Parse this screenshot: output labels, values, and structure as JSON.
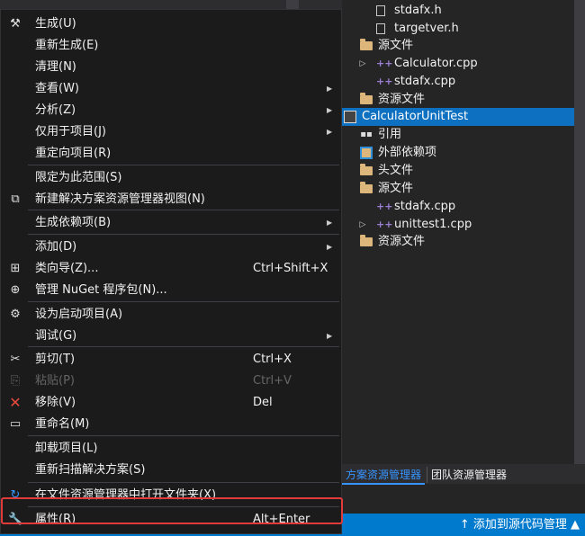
{
  "solution_explorer": {
    "items": [
      {
        "label": "stdafx.h",
        "icon": "header-file-icon",
        "depth": 2,
        "arrow": ""
      },
      {
        "label": "targetver.h",
        "icon": "header-file-icon",
        "depth": 2,
        "arrow": ""
      },
      {
        "label": "源文件",
        "icon": "folder-icon",
        "depth": 1,
        "arrow": ""
      },
      {
        "label": "Calculator.cpp",
        "icon": "cpp-file-icon",
        "depth": 2,
        "arrow": "▷"
      },
      {
        "label": "stdafx.cpp",
        "icon": "cpp-file-icon",
        "depth": 2,
        "arrow": ""
      },
      {
        "label": "资源文件",
        "icon": "folder-icon",
        "depth": 1,
        "arrow": ""
      },
      {
        "label": "CalculatorUnitTest",
        "icon": "project-icon",
        "depth": 0,
        "arrow": "",
        "selected": true
      },
      {
        "label": "引用",
        "icon": "references-icon",
        "depth": 1,
        "arrow": ""
      },
      {
        "label": "外部依赖项",
        "icon": "external-deps-icon",
        "depth": 1,
        "arrow": ""
      },
      {
        "label": "头文件",
        "icon": "folder-icon",
        "depth": 1,
        "arrow": ""
      },
      {
        "label": "源文件",
        "icon": "folder-icon",
        "depth": 1,
        "arrow": ""
      },
      {
        "label": "stdafx.cpp",
        "icon": "cpp-file-icon",
        "depth": 2,
        "arrow": ""
      },
      {
        "label": "unittest1.cpp",
        "icon": "cpp-file-icon",
        "depth": 2,
        "arrow": "▷"
      },
      {
        "label": "资源文件",
        "icon": "folder-icon",
        "depth": 1,
        "arrow": ""
      }
    ],
    "tabs": [
      {
        "label": "方案资源管理器",
        "active": true
      },
      {
        "label": "团队资源管理器",
        "active": false
      }
    ]
  },
  "status_bar": {
    "source_control": "↑ 添加到源代码管理 ▲"
  },
  "context_menu": {
    "items": [
      {
        "name": "build",
        "label": "生成(U)",
        "shortcut": "",
        "icon": "build-icon",
        "submenu": false,
        "disabled": false
      },
      {
        "name": "rebuild",
        "label": "重新生成(E)",
        "shortcut": "",
        "icon": "",
        "submenu": false,
        "disabled": false
      },
      {
        "name": "clean",
        "label": "清理(N)",
        "shortcut": "",
        "icon": "",
        "submenu": false,
        "disabled": false
      },
      {
        "name": "view",
        "label": "查看(W)",
        "shortcut": "",
        "icon": "",
        "submenu": true,
        "disabled": false
      },
      {
        "name": "analyze",
        "label": "分析(Z)",
        "shortcut": "",
        "icon": "",
        "submenu": true,
        "disabled": false
      },
      {
        "name": "project-only",
        "label": "仅用于项目(J)",
        "shortcut": "",
        "icon": "",
        "submenu": true,
        "disabled": false
      },
      {
        "name": "retarget",
        "label": "重定向项目(R)",
        "shortcut": "",
        "icon": "",
        "submenu": false,
        "disabled": false
      },
      {
        "name": "scope-to-this",
        "label": "限定为此范围(S)",
        "shortcut": "",
        "icon": "",
        "submenu": false,
        "disabled": false
      },
      {
        "name": "new-explorer-view",
        "label": "新建解决方案资源管理器视图(N)",
        "shortcut": "",
        "icon": "new-view-icon",
        "submenu": false,
        "disabled": false
      },
      {
        "name": "build-dependencies",
        "label": "生成依赖项(B)",
        "shortcut": "",
        "icon": "",
        "submenu": true,
        "disabled": false
      },
      {
        "name": "add",
        "label": "添加(D)",
        "shortcut": "",
        "icon": "",
        "submenu": true,
        "disabled": false
      },
      {
        "name": "class-wizard",
        "label": "类向导(Z)...",
        "shortcut": "Ctrl+Shift+X",
        "icon": "class-wizard-icon",
        "submenu": false,
        "disabled": false
      },
      {
        "name": "manage-nuget",
        "label": "管理 NuGet 程序包(N)...",
        "shortcut": "",
        "icon": "nuget-icon",
        "submenu": false,
        "disabled": false
      },
      {
        "name": "set-startup",
        "label": "设为启动项目(A)",
        "shortcut": "",
        "icon": "gear-icon",
        "submenu": false,
        "disabled": false
      },
      {
        "name": "debug",
        "label": "调试(G)",
        "shortcut": "",
        "icon": "",
        "submenu": true,
        "disabled": false
      },
      {
        "name": "cut",
        "label": "剪切(T)",
        "shortcut": "Ctrl+X",
        "icon": "scissors-icon",
        "submenu": false,
        "disabled": false
      },
      {
        "name": "paste",
        "label": "粘贴(P)",
        "shortcut": "Ctrl+V",
        "icon": "paste-icon",
        "submenu": false,
        "disabled": true
      },
      {
        "name": "remove",
        "label": "移除(V)",
        "shortcut": "Del",
        "icon": "remove-icon",
        "submenu": false,
        "disabled": false
      },
      {
        "name": "rename",
        "label": "重命名(M)",
        "shortcut": "",
        "icon": "rename-icon",
        "submenu": false,
        "disabled": false
      },
      {
        "name": "unload",
        "label": "卸载项目(L)",
        "shortcut": "",
        "icon": "",
        "submenu": false,
        "disabled": false
      },
      {
        "name": "rescan",
        "label": "重新扫描解决方案(S)",
        "shortcut": "",
        "icon": "",
        "submenu": false,
        "disabled": false
      },
      {
        "name": "open-in-explorer",
        "label": "在文件资源管理器中打开文件夹(X)",
        "shortcut": "",
        "icon": "open-folder-icon",
        "submenu": false,
        "disabled": false
      },
      {
        "name": "properties",
        "label": "属性(R)",
        "shortcut": "Alt+Enter",
        "icon": "wrench-icon",
        "submenu": false,
        "disabled": false,
        "highlighted": true
      }
    ]
  }
}
